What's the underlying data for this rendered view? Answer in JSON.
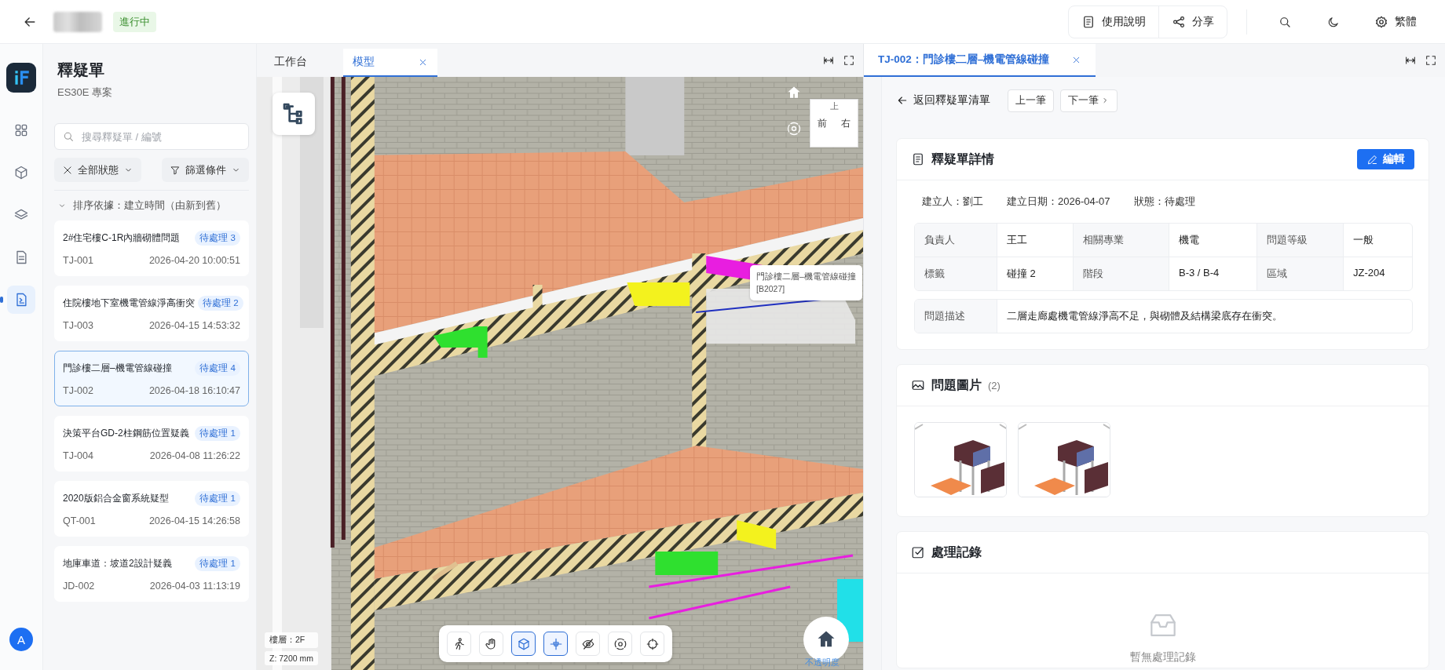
{
  "header": {
    "status_badge": "進行中",
    "actions": [
      {
        "kind": "doc",
        "label": "使用說明"
      },
      {
        "kind": "share",
        "label": "分享"
      }
    ],
    "tools": [
      {
        "kind": "search"
      },
      {
        "kind": "moon"
      },
      {
        "kind": "gear",
        "label": "繁體"
      }
    ]
  },
  "rail": {
    "items": [
      {
        "kind": "grid",
        "selected": false
      },
      {
        "kind": "cube",
        "selected": false
      },
      {
        "kind": "layers",
        "selected": false
      },
      {
        "kind": "file",
        "selected": false
      },
      {
        "kind": "doc-check",
        "selected": true
      }
    ],
    "avatar": "A"
  },
  "list_panel": {
    "title": "釋疑單",
    "subtitle": "ES30E 專案",
    "search": {
      "placeholder": "搜尋釋疑單 / 編號"
    },
    "filters": [
      {
        "kind": "status",
        "label": "全部狀態"
      },
      {
        "kind": "funnel",
        "label": "篩選條件"
      }
    ],
    "sort": "排序依據：建立時間（由新到舊）",
    "items": [
      {
        "title": "2#住宅樓C-1R內牆砌體問題",
        "badge": "待處理 3",
        "code": "TJ-001",
        "time": "2026-04-20 10:00:51",
        "selected": false
      },
      {
        "title": "住院樓地下室機電管線淨高衝突",
        "badge": "待處理 2",
        "code": "TJ-003",
        "time": "2026-04-15 14:53:32",
        "selected": false
      },
      {
        "title": "門診樓二層–機電管線碰撞",
        "badge": "待處理 4",
        "code": "TJ-002",
        "time": "2026-04-18 16:10:47",
        "selected": true
      },
      {
        "title": "決策平台GD-2柱鋼筋位置疑義",
        "badge": "待處理 1",
        "code": "TJ-004",
        "time": "2026-04-08 11:26:22",
        "selected": false
      },
      {
        "title": "2020版鋁合金窗系統疑型",
        "badge": "待處理 1",
        "code": "QT-001",
        "time": "2026-04-15 14:26:58",
        "selected": false
      },
      {
        "title": "地庫車道：坡道2設計疑義",
        "badge": "待處理 1",
        "code": "JD-002",
        "time": "2026-04-03 11:13:19",
        "selected": false
      }
    ]
  },
  "viewer": {
    "tabs": [
      {
        "label": "工作台",
        "selected": false,
        "closable": false
      },
      {
        "label": "模型",
        "selected": true,
        "closable": true
      }
    ],
    "view_cube": {
      "top": "上",
      "front": "前",
      "right": "右"
    },
    "tooltip": {
      "title": "門診樓二層–機電管線碰撞",
      "code": "[B2027]"
    },
    "floor_info": [
      "樓層：2F",
      "Z: 7200 mm"
    ],
    "toolbar": [
      {
        "kind": "walk",
        "selected": false
      },
      {
        "kind": "hand",
        "selected": false
      },
      {
        "kind": "cube",
        "selected": true
      },
      {
        "kind": "section",
        "selected": true
      },
      {
        "kind": "eye",
        "selected": false
      },
      {
        "kind": "orbit",
        "selected": false
      },
      {
        "kind": "target",
        "selected": false
      }
    ],
    "opacity_label": "不透明度"
  },
  "detail": {
    "tab": {
      "label": "TJ-002：門診樓二層–機電管線碰撞",
      "selected": true
    },
    "back": "返回釋疑單清單",
    "prev": "上一筆",
    "next": "下一筆",
    "info_card": {
      "title": "釋疑單詳情",
      "edit": "編輯",
      "meta": [
        "建立人：劉工",
        "建立日期：2026-04-07",
        "狀態：待處理"
      ],
      "rows": [
        [
          {
            "label": "負責人",
            "value": "王工"
          },
          {
            "label": "相關專業",
            "value": "機電"
          },
          {
            "label": "問題等級",
            "value": "一般"
          }
        ],
        [
          {
            "label": "標籤",
            "value": "碰撞 2"
          },
          {
            "label": "階段",
            "value": "B-3 / B-4"
          },
          {
            "label": "區域",
            "value": "JZ-204"
          }
        ]
      ],
      "description": {
        "label": "問題描述",
        "value": "二層走廊處機電管線淨高不足，與砌體及結構梁底存在衝突。"
      }
    },
    "images_card": {
      "title": "問題圖片",
      "count": "(2)",
      "images": [
        {
          "kind": "model-snapshot"
        },
        {
          "kind": "model-snapshot"
        }
      ]
    },
    "records_card": {
      "title": "處理記錄",
      "empty": "暫無處理記錄"
    }
  }
}
